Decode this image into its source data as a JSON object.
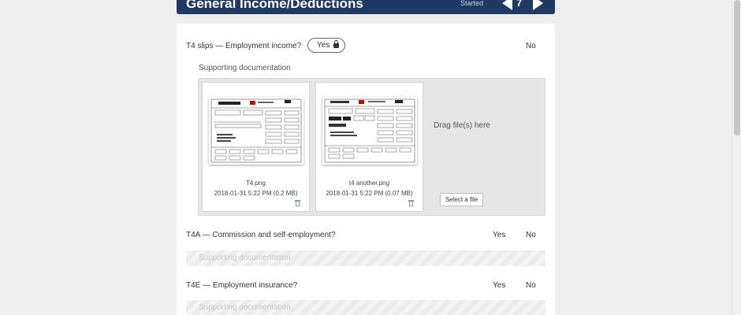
{
  "header": {
    "title": "General Income/Deductions",
    "status": "Started",
    "counter": "7"
  },
  "questions": [
    {
      "label": "T4 slips — Employment income?",
      "yes": "Yes",
      "no": "No",
      "selected": "Yes",
      "locked": true,
      "supporting_label": "Supporting documentation",
      "files": [
        {
          "name": "T4.png",
          "meta": "2018-01-31 5:22 PM (0.2 MB)"
        },
        {
          "name": "t4 another.png",
          "meta": "2018-01-31 5:22 PM (0.07 MB)"
        }
      ],
      "drag_text": "Drag file(s) here",
      "select_label": "Select a file"
    },
    {
      "label": "T4A — Commission and self-employment?",
      "yes": "Yes",
      "no": "No",
      "supporting_label": "Supporting documentation"
    },
    {
      "label": "T4E — Employment insurance?",
      "yes": "Yes",
      "no": "No",
      "supporting_label": "Supporting documentation"
    }
  ],
  "colors": {
    "header_bg": "#1e3a64",
    "page_bg": "#efefef",
    "trash": "#7a9ac0"
  }
}
